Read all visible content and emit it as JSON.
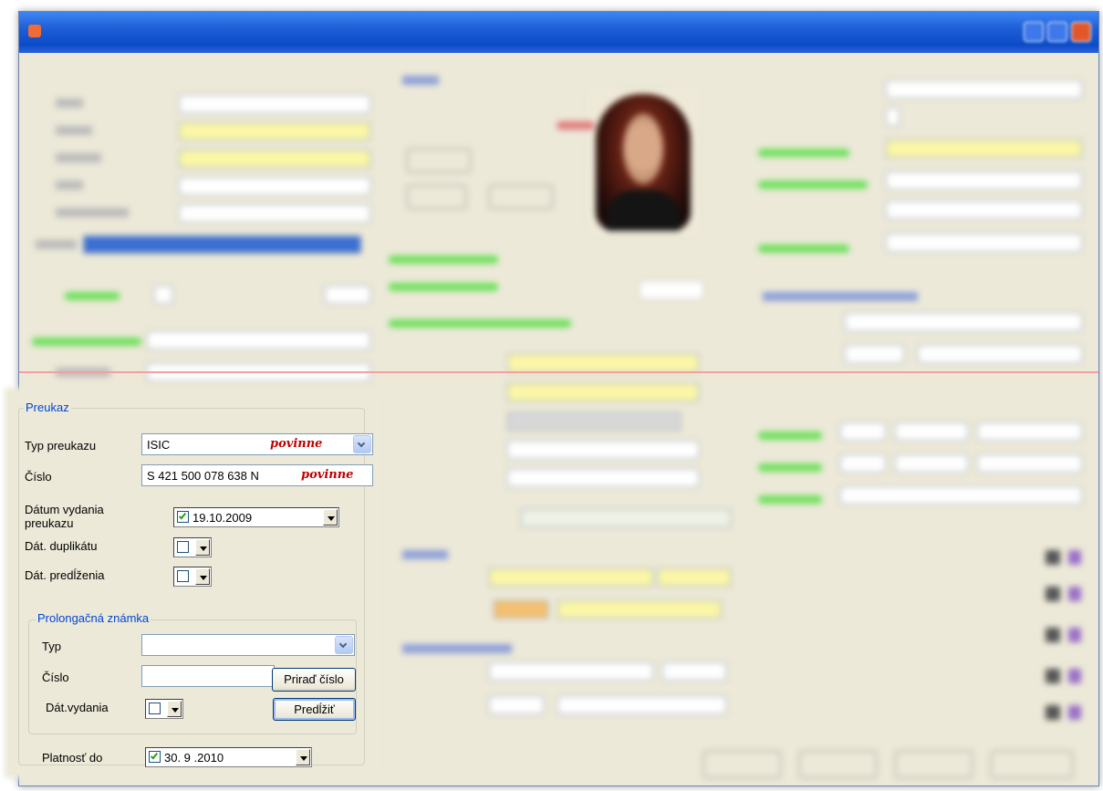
{
  "preukaz": {
    "group_title": "Preukaz",
    "typ_label": "Typ preukazu",
    "typ_value": "ISIC",
    "cislo_label": "Číslo",
    "cislo_value": "S 421 500 078 638 N",
    "required_mark": "povinne",
    "datum_vydania_label": "Dátum vydania preukazu",
    "datum_vydania_value": "19.10.2009",
    "datum_vydania_checked": true,
    "dat_duplikatu_label": "Dát. duplikátu",
    "dat_duplikatu_checked": false,
    "dat_predlzenia_label": "Dát. predĺženia",
    "dat_predlzenia_checked": false
  },
  "prolongacna": {
    "group_title": "Prolongačná známka",
    "typ_label": "Typ",
    "typ_value": "",
    "cislo_label": "Číslo",
    "cislo_value": "",
    "assign_button": "Priraď číslo",
    "dat_vydania_label": "Dát.vydania",
    "dat_vydania_checked": false,
    "extend_button": "Predĺžiť"
  },
  "platnost": {
    "label": "Platnosť do",
    "value": "30. 9 .2010",
    "checked": true
  },
  "colors": {
    "group_title": "#0046d5",
    "required_mark": "#c00000",
    "titlebar": "#0b4bc7"
  }
}
